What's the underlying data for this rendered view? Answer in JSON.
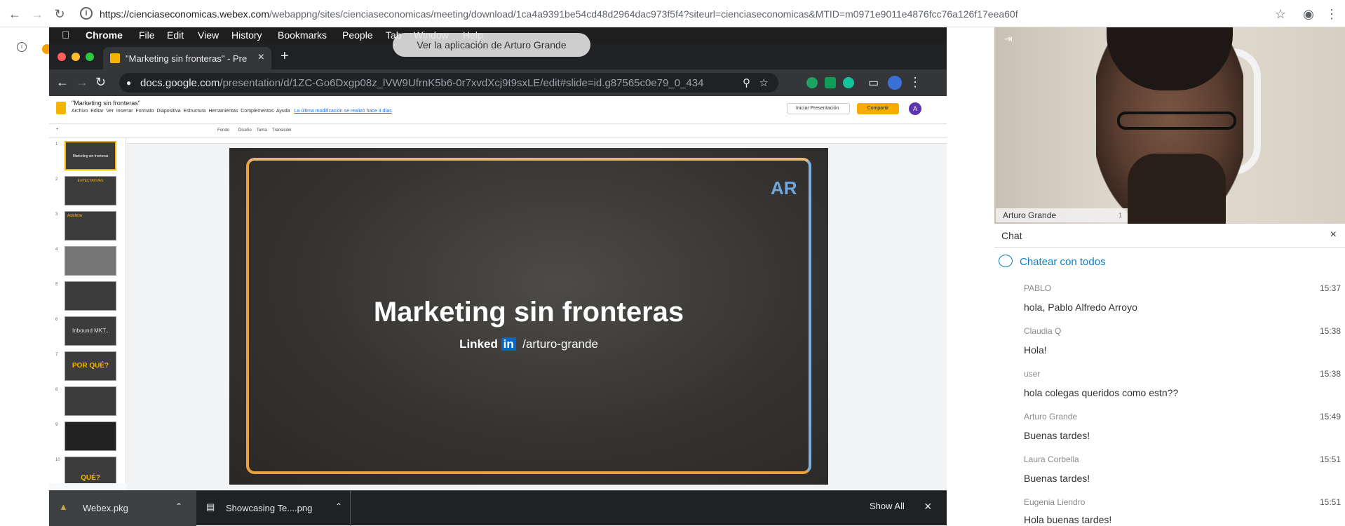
{
  "outer_browser": {
    "url_host": "https://cienciaseconomicas.webex.com",
    "url_rest": "/webappng/sites/cienciaseconomicas/meeting/download/1ca4a9391be54cd48d2964dac973f5f4?siteurl=cienciaseconomicas&MTID=m0971e9011e4876fcc76a126f17eea60f"
  },
  "mac_menu": {
    "app": "Chrome",
    "items": [
      "File",
      "Edit",
      "View",
      "History",
      "Bookmarks",
      "People",
      "Tab",
      "Window",
      "Help"
    ]
  },
  "app_tooltip": "Ver la aplicación de Arturo Grande",
  "inner_browser": {
    "tab_title": "\"Marketing sin fronteras\" - Pre",
    "url_host": "docs.google.com",
    "url_rest": "/presentation/d/1ZC-Go6Dxgp08z_lVW9UfrnK5b6-0r7xvdXcj9t9sxLE/edit#slide=id.g87565c0e79_0_434"
  },
  "slides_app": {
    "doc_title": "\"Marketing sin fronteras\"",
    "menus": [
      "Archivo",
      "Editar",
      "Ver",
      "Insertar",
      "Formato",
      "Diapositiva",
      "Estructura",
      "Herramientas",
      "Complementos",
      "Ayuda"
    ],
    "last_edit": "La última modificación se realizó hace 3 días",
    "present_label": "Iniciar Presentación",
    "share_label": "Compartir",
    "toolbar_items": [
      "Fondo",
      "Diseño",
      "Tema",
      "Transición"
    ],
    "thumbs": [
      {
        "n": "1",
        "label": "Marketing sin fronteras"
      },
      {
        "n": "2",
        "label": "EXPECTATIVAS"
      },
      {
        "n": "3",
        "label": "AGENDA"
      },
      {
        "n": "4",
        "label": ""
      },
      {
        "n": "5",
        "label": ""
      },
      {
        "n": "6",
        "label": "Inbound MKT..."
      },
      {
        "n": "7",
        "label": "POR QUÉ?"
      },
      {
        "n": "8",
        "label": ""
      },
      {
        "n": "9",
        "label": ""
      },
      {
        "n": "10",
        "label": "QUÉ?"
      }
    ],
    "slide_title": "Marketing sin fronteras",
    "slide_linkedin_word": "Linked",
    "slide_linkedin_in": "in",
    "slide_handle": "/arturo-grande",
    "slide_logo": "AR"
  },
  "downloads": {
    "items": [
      "Webex.pkg",
      "Showcasing Te....png"
    ],
    "show_all": "Show All"
  },
  "video": {
    "participant": "Arturo Grande",
    "badge": "1"
  },
  "chat": {
    "title": "Chat",
    "scope": "Chatear con todos",
    "messages": [
      {
        "from": "PABLO",
        "time": "15:37",
        "text": "hola, Pablo Alfredo Arroyo"
      },
      {
        "from": "Claudia Q",
        "time": "15:38",
        "text": "Hola!"
      },
      {
        "from": "user",
        "time": "15:38",
        "text": "hola colegas queridos como estn??"
      },
      {
        "from": "Arturo Grande",
        "time": "15:49",
        "text": "Buenas tardes!"
      },
      {
        "from": "Laura Corbella",
        "time": "15:51",
        "text": "Buenas tardes!"
      },
      {
        "from": "Eugenia Liendro",
        "time": "15:51",
        "text": "Hola buenas tardes!"
      }
    ]
  }
}
